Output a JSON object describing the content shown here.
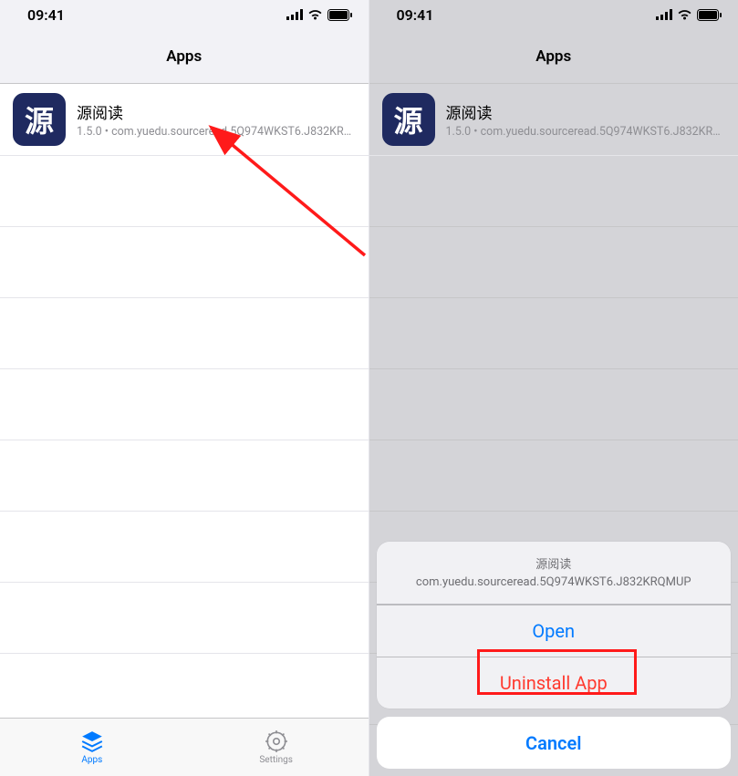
{
  "status": {
    "time": "09:41"
  },
  "nav": {
    "title": "Apps"
  },
  "app": {
    "name": "源阅读",
    "subtitle": "1.5.0  •  com.yuedu.sourceread.5Q974WKST6.J832KRQ...",
    "icon_glyph": "源"
  },
  "tabs": {
    "apps": "Apps",
    "settings": "Settings"
  },
  "sheet": {
    "title": "源阅读",
    "subtitle": "com.yuedu.sourceread.5Q974WKST6.J832KRQMUP",
    "open": "Open",
    "uninstall": "Uninstall App",
    "cancel": "Cancel"
  }
}
